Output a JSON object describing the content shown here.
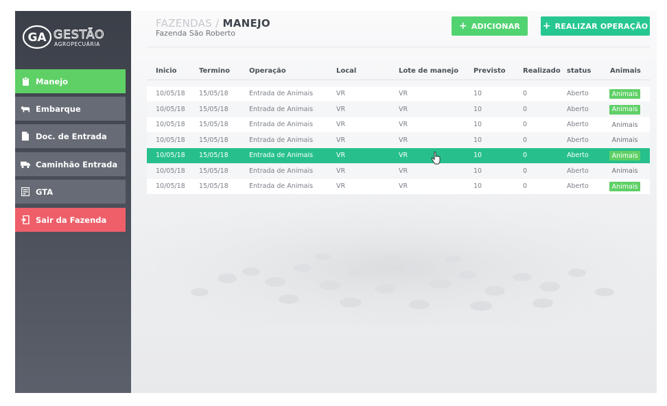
{
  "brand": {
    "logo_mark": "GA",
    "name": "GESTÃO",
    "tagline": "AGROPECUÁRIA"
  },
  "sidebar": {
    "items": [
      {
        "label": "Manejo",
        "icon": "clipboard-icon",
        "state": "active"
      },
      {
        "label": "Embarque",
        "icon": "cow-icon",
        "state": "normal"
      },
      {
        "label": "Doc. de Entrada",
        "icon": "document-icon",
        "state": "normal"
      },
      {
        "label": "Caminhão Entrada",
        "icon": "truck-icon",
        "state": "normal"
      },
      {
        "label": "GTA",
        "icon": "form-icon",
        "state": "normal"
      },
      {
        "label": "Sair da Fazenda",
        "icon": "exit-icon",
        "state": "danger"
      }
    ]
  },
  "header": {
    "breadcrumb_parent": "FAZENDAS",
    "breadcrumb_sep": " / ",
    "breadcrumb_current": "MANEJO",
    "subtitle": "Fazenda São Roberto",
    "add_button": "ADICIONAR",
    "operation_button": "REALIZAR OPERAÇÃO",
    "plus_symbol": "+"
  },
  "table": {
    "columns": [
      "Inicio",
      "Termino",
      "Operação",
      "Local",
      "Lote de manejo",
      "Previsto",
      "Realizado",
      "status",
      "Animais"
    ],
    "rows": [
      {
        "inicio": "10/05/18",
        "termino": "15/05/18",
        "operacao": "Entrada de Animais",
        "local": "VR",
        "lote": "VR",
        "previsto": "10",
        "realizado": "0",
        "status": "Aberto",
        "animais": "Animais",
        "animais_style": "green",
        "selected": false
      },
      {
        "inicio": "10/05/18",
        "termino": "15/05/18",
        "operacao": "Entrada de Animais",
        "local": "VR",
        "lote": "VR",
        "previsto": "10",
        "realizado": "0",
        "status": "Aberto",
        "animais": "Animais",
        "animais_style": "green",
        "selected": false
      },
      {
        "inicio": "10/05/18",
        "termino": "15/05/18",
        "operacao": "Entrada de Animais",
        "local": "VR",
        "lote": "VR",
        "previsto": "10",
        "realizado": "0",
        "status": "Aberto",
        "animais": "Animais",
        "animais_style": "plain",
        "selected": false
      },
      {
        "inicio": "10/05/18",
        "termino": "15/05/18",
        "operacao": "Entrada de Animais",
        "local": "VR",
        "lote": "VR",
        "previsto": "10",
        "realizado": "0",
        "status": "Aberto",
        "animais": "Animais",
        "animais_style": "plain",
        "selected": false
      },
      {
        "inicio": "10/05/18",
        "termino": "15/05/18",
        "operacao": "Entrada de Animais",
        "local": "VR",
        "lote": "VR",
        "previsto": "10",
        "realizado": "0",
        "status": "Aberto",
        "animais": "Animais",
        "animais_style": "green",
        "selected": true
      },
      {
        "inicio": "10/05/18",
        "termino": "15/05/18",
        "operacao": "Entrada de Animais",
        "local": "VR",
        "lote": "VR",
        "previsto": "10",
        "realizado": "0",
        "status": "Aberto",
        "animais": "Animais",
        "animais_style": "plain",
        "selected": false
      },
      {
        "inicio": "10/05/18",
        "termino": "15/05/18",
        "operacao": "Entrada de Animais",
        "local": "VR",
        "lote": "VR",
        "previsto": "10",
        "realizado": "0",
        "status": "Aberto",
        "animais": "Animais",
        "animais_style": "green",
        "selected": false
      }
    ]
  },
  "colors": {
    "sidebar_bg": "#444852",
    "active_green": "#5fd066",
    "exit_red": "#ee5f6a",
    "operation_teal": "#27c791",
    "selected_row": "#27c08d"
  }
}
